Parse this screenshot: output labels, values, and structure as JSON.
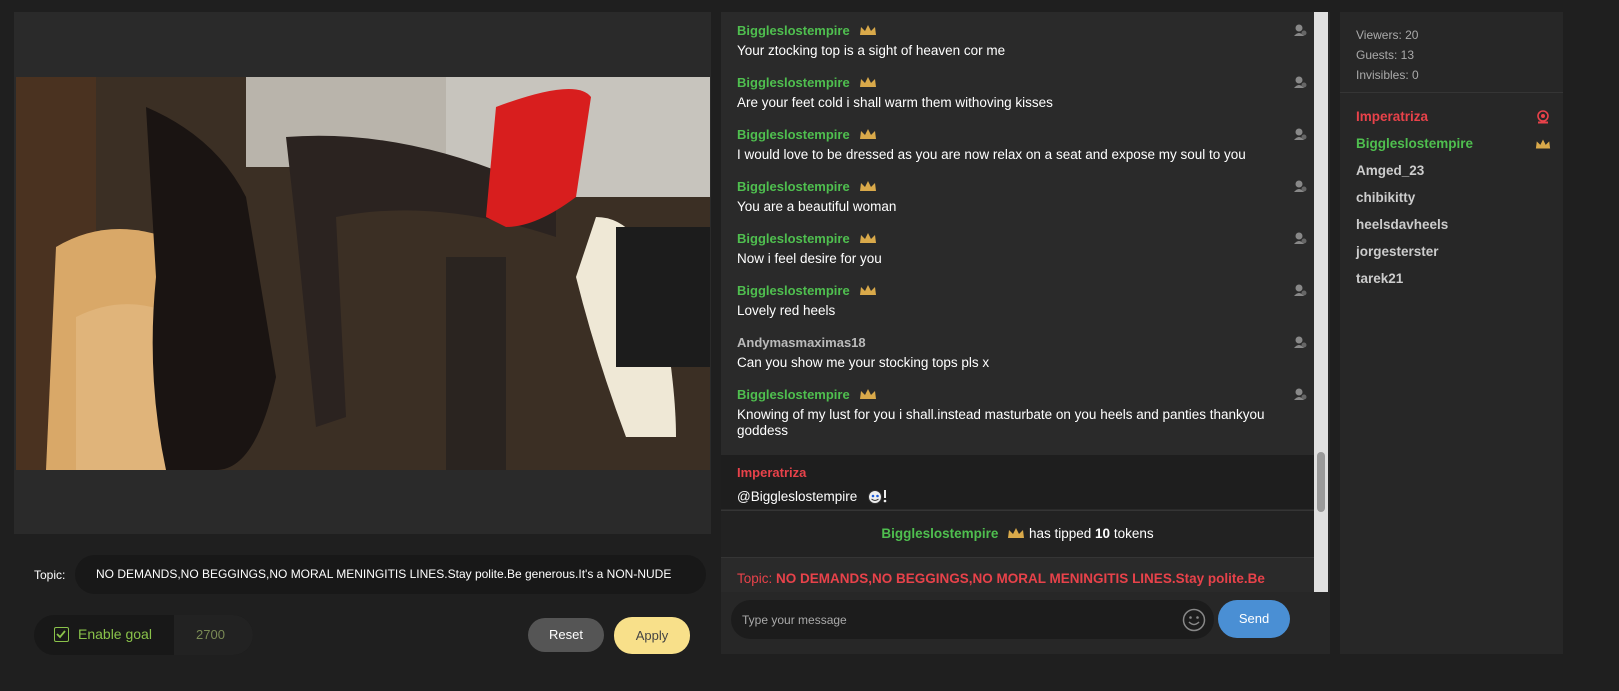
{
  "video": {
    "topic_label": "Topic:",
    "topic_text": "NO DEMANDS,NO BEGGINGS,NO MORAL MENINGITIS LINES.Stay polite.Be generous.It's a NON-NUDE",
    "goal": {
      "label": "Enable goal",
      "value": "2700",
      "checked": true
    },
    "reset_label": "Reset",
    "apply_label": "Apply"
  },
  "chat": {
    "messages": [
      {
        "user": "Biggleslostempire",
        "crown": true,
        "text": "Your ztocking top is a sight of heaven cor me"
      },
      {
        "user": "Biggleslostempire",
        "crown": true,
        "text": "Are your feet cold i shall warm them withoving kisses"
      },
      {
        "user": "Biggleslostempire",
        "crown": true,
        "text": "I would love to be dressed as you are now relax on a seat and expose my soul to you"
      },
      {
        "user": "Biggleslostempire",
        "crown": true,
        "text": "You are a beautiful woman"
      },
      {
        "user": "Biggleslostempire",
        "crown": true,
        "text": "Now i feel desire for you"
      },
      {
        "user": "Biggleslostempire",
        "crown": true,
        "text": "Lovely red heels"
      },
      {
        "user": "Andymasmaximas18",
        "crown": false,
        "text": "Can you show me your stocking tops pls x"
      },
      {
        "user": "Biggleslostempire",
        "crown": true,
        "text": "Knowing of my lust for you i shall.instead masturbate on you heels and panties thankyou goddess"
      },
      {
        "user": "Imperatriza",
        "crown": false,
        "text": "@Biggleslostempire"
      }
    ],
    "tip": {
      "user": "Biggleslostempire",
      "pre": "has tipped",
      "amount": "10",
      "post": "tokens"
    },
    "topic_prefix": "Topic:",
    "topic_text": "NO DEMANDS,NO BEGGINGS,NO MORAL MENINGITIS LINES.Stay polite.Be",
    "input_placeholder": "Type your message",
    "send_label": "Send"
  },
  "users": {
    "viewers": "Viewers: 20",
    "guests": "Guests: 13",
    "invisibles": "Invisibles: 0",
    "list": [
      {
        "name": "Imperatriza",
        "badge": "webcam-icon"
      },
      {
        "name": "Biggleslostempire",
        "badge": "crown-icon"
      },
      {
        "name": "Amged_23"
      },
      {
        "name": "chibikitty"
      },
      {
        "name": "heelsdavheels"
      },
      {
        "name": "jorgesterster"
      },
      {
        "name": "tarek21"
      }
    ]
  },
  "colors": {
    "green_user": "#4fbf4f",
    "red_user": "#e8424a",
    "crown": "#d9a94a",
    "send": "#4a8fd4",
    "apply": "#f8e08a"
  }
}
